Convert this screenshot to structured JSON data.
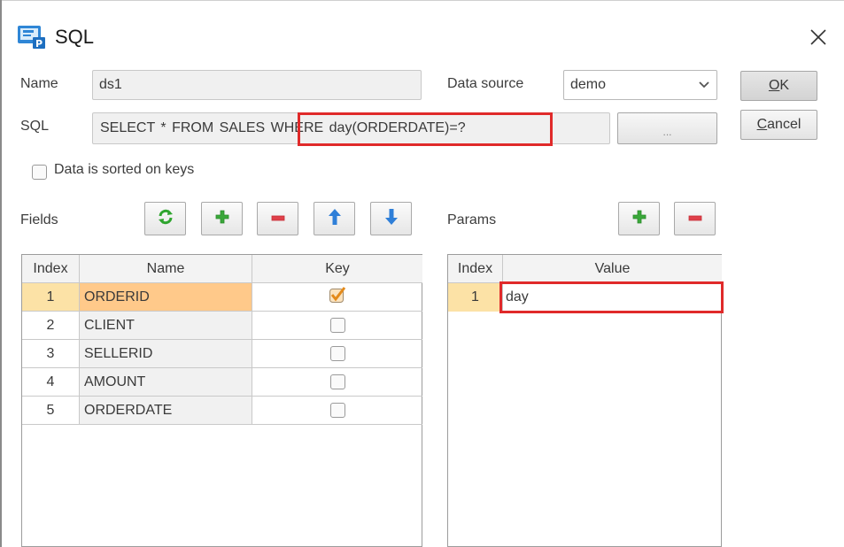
{
  "window": {
    "title": "SQL",
    "icon": "sql-dataset-icon",
    "close_icon": "close-icon"
  },
  "form": {
    "name_label": "Name",
    "name_value": "ds1",
    "datasource_label": "Data source",
    "datasource_value": "demo",
    "sql_label": "SQL",
    "sql_value": "SELECT * FROM SALES WHERE day(ORDERDATE)=?",
    "sql_browse_label": "...",
    "sorted_checkbox_label": "Data is sorted on keys",
    "sorted_checked": false
  },
  "buttons": {
    "ok": "OK",
    "cancel": "Cancel"
  },
  "fields": {
    "label": "Fields",
    "toolbar": [
      "refresh-icon",
      "add-icon",
      "remove-icon",
      "move-up-icon",
      "move-down-icon"
    ],
    "columns": [
      "Index",
      "Name",
      "Key"
    ],
    "rows": [
      {
        "index": "1",
        "name": "ORDERID",
        "key": true,
        "selected": true
      },
      {
        "index": "2",
        "name": "CLIENT",
        "key": false,
        "selected": false
      },
      {
        "index": "3",
        "name": "SELLERID",
        "key": false,
        "selected": false
      },
      {
        "index": "4",
        "name": "AMOUNT",
        "key": false,
        "selected": false
      },
      {
        "index": "5",
        "name": "ORDERDATE",
        "key": false,
        "selected": false
      }
    ]
  },
  "params": {
    "label": "Params",
    "toolbar": [
      "add-icon",
      "remove-icon"
    ],
    "columns": [
      "Index",
      "Value"
    ],
    "rows": [
      {
        "index": "1",
        "value": "day",
        "selected": true
      }
    ]
  },
  "colors": {
    "highlight": "#e02a2a",
    "selection": "#ffc98a",
    "selection_index": "#fce2a6",
    "add": "#3aa83a",
    "remove": "#e0404a",
    "arrows": "#2f7fd8"
  }
}
